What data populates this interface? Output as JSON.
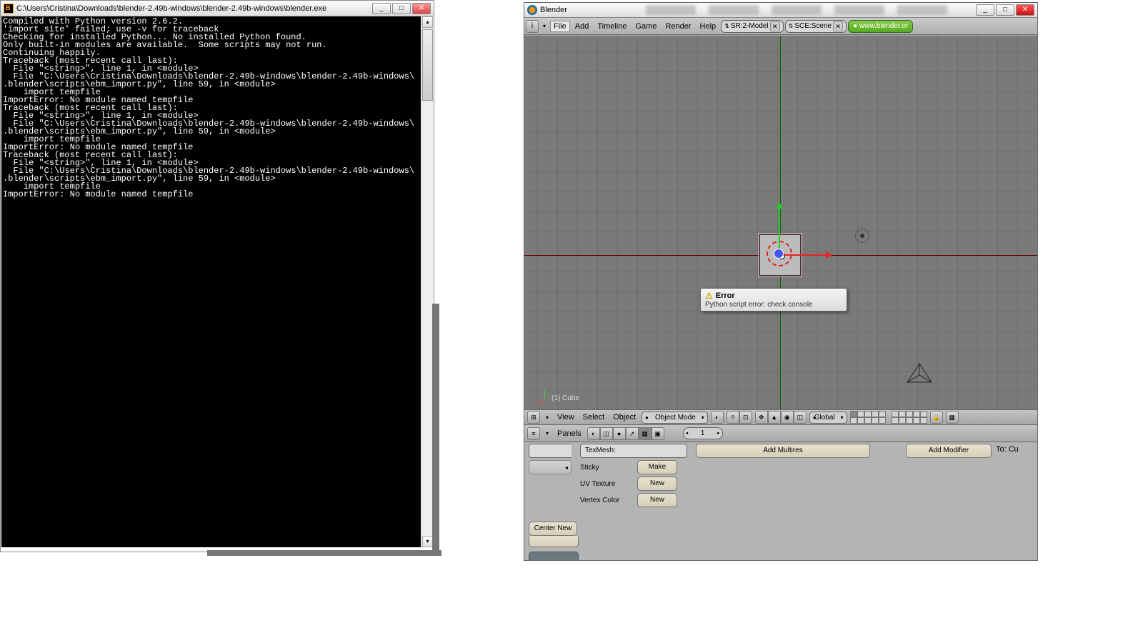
{
  "console": {
    "title": "C:\\Users\\Cristina\\Downloads\\blender-2.49b-windows\\blender-2.49b-windows\\blender.exe",
    "body": "Compiled with Python version 2.6.2.\n'import site' failed; use -v for traceback\nChecking for installed Python... No installed Python found.\nOnly built-in modules are available.  Some scripts may not run.\nContinuing happily.\nTraceback (most recent call last):\n  File \"<string>\", line 1, in <module>\n  File \"C:\\Users\\Cristina\\Downloads\\blender-2.49b-windows\\blender-2.49b-windows\\\n.blender\\scripts\\ebm_import.py\", line 59, in <module>\n    import tempfile\nImportError: No module named tempfile\nTraceback (most recent call last):\n  File \"<string>\", line 1, in <module>\n  File \"C:\\Users\\Cristina\\Downloads\\blender-2.49b-windows\\blender-2.49b-windows\\\n.blender\\scripts\\ebm_import.py\", line 59, in <module>\n    import tempfile\nImportError: No module named tempfile\nTraceback (most recent call last):\n  File \"<string>\", line 1, in <module>\n  File \"C:\\Users\\Cristina\\Downloads\\blender-2.49b-windows\\blender-2.49b-windows\\\n.blender\\scripts\\ebm_import.py\", line 59, in <module>\n    import tempfile\nImportError: No module named tempfile"
  },
  "blender": {
    "title": "Blender",
    "menu": {
      "file": "File",
      "add": "Add",
      "timeline": "Timeline",
      "game": "Game",
      "render": "Render",
      "help": "Help"
    },
    "screen_field": "SR:2-Model",
    "scene_field": "SCE:Scene",
    "url_field": "www.blender.or",
    "viewport": {
      "object_label": "(1) Cube",
      "error_title": "Error",
      "error_msg": "Python script error: check console"
    },
    "view_header": {
      "view": "View",
      "select": "Select",
      "object": "Object",
      "mode": "Object Mode",
      "orient": "Global"
    },
    "panels_header": {
      "label": "Panels",
      "frame": "1"
    },
    "panels": {
      "texmesh": "TexMesh:",
      "sticky": "Sticky",
      "sticky_btn": "Make",
      "uvtex": "UV Texture",
      "uvtex_btn": "New",
      "vcol": "Vertex Color",
      "vcol_btn": "New",
      "center_new": "Center New",
      "multires": "Add Multires",
      "modifier": "Add Modifier",
      "to": "To: Cu"
    }
  }
}
